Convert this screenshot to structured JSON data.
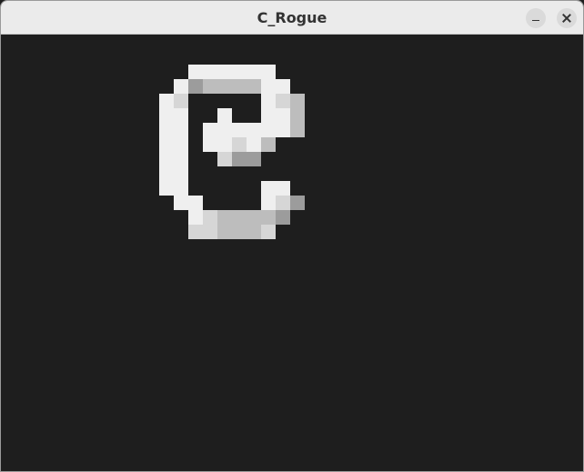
{
  "window": {
    "title": "C_Rogue",
    "minimize_icon": "minimize-icon",
    "close_icon": "close-icon"
  },
  "game": {
    "background_color": "#1e1e1e",
    "player": {
      "glyph": "@",
      "color": "#f0f0f0"
    }
  }
}
